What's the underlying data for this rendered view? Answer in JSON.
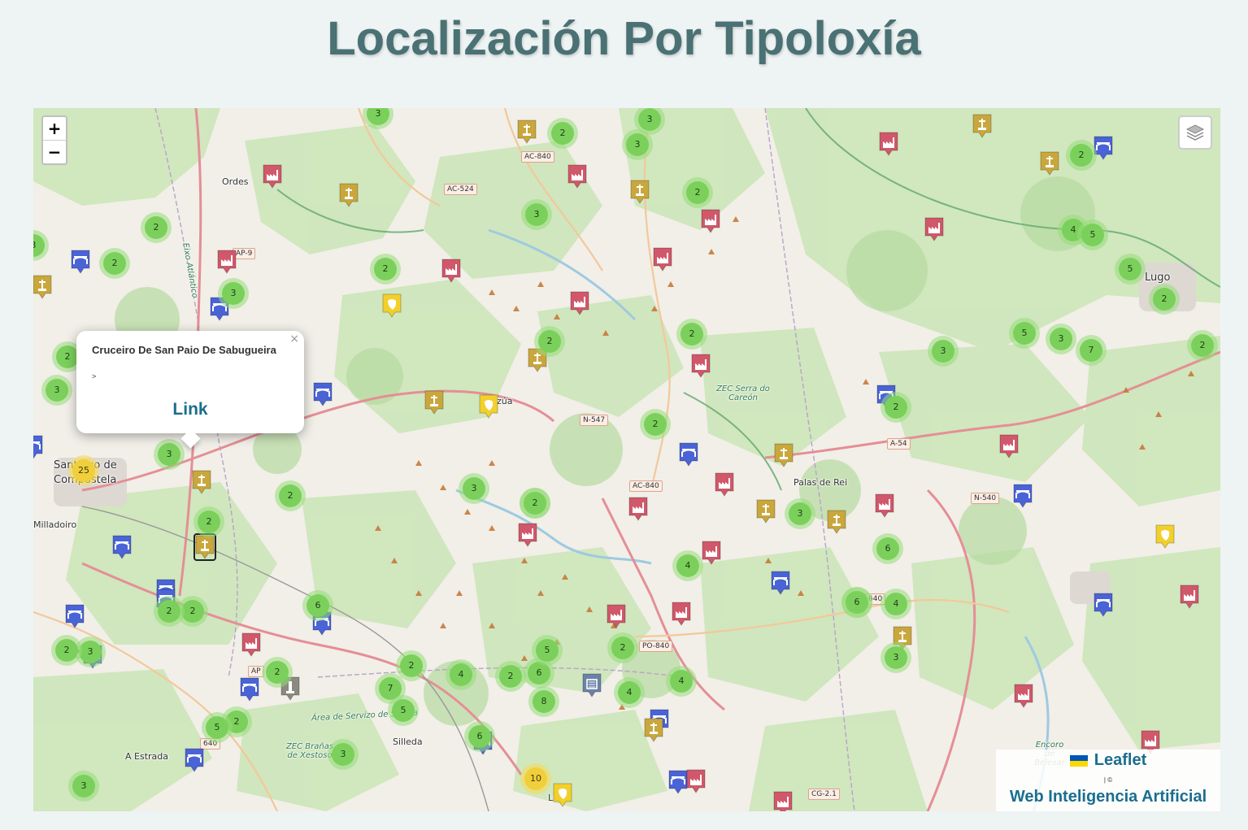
{
  "page": {
    "title": "Localización Por Tipoloxía"
  },
  "map": {
    "zoom_in_label": "+",
    "zoom_out_label": "−",
    "layers_icon": "layers-icon",
    "place_labels": [
      {
        "text": "Ordes",
        "cls": ""
      },
      {
        "text": "Lugo",
        "cls": "big"
      },
      {
        "text": "Santiago de",
        "cls": "big"
      },
      {
        "text": "Compostela",
        "cls": "big"
      },
      {
        "text": "Milladoiro",
        "cls": ""
      },
      {
        "text": "Palas de Rei",
        "cls": ""
      },
      {
        "text": "A Estrada",
        "cls": ""
      },
      {
        "text": "Silleda",
        "cls": ""
      },
      {
        "text": "Lalín",
        "cls": ""
      },
      {
        "text": "zúa",
        "cls": ""
      },
      {
        "text": "ZEC Serra do Careón",
        "cls": "italic"
      },
      {
        "text": "Área de Servizo de Silleda",
        "cls": "italic"
      },
      {
        "text": "ZEC Brañas de Xestoso",
        "cls": "italic"
      },
      {
        "text": "Encoro de Belesar",
        "cls": "italic"
      },
      {
        "text": "Eixo Atlántico",
        "cls": "italic"
      }
    ],
    "road_refs": [
      "AC-840",
      "AC-524",
      "N-547",
      "A-54",
      "AC-840",
      "N-540",
      "PO-840",
      "CG-2.1",
      "AP-9",
      "640",
      "PO",
      "AP",
      "640"
    ],
    "clusters": [
      {
        "count": "3",
        "color": "green"
      },
      {
        "count": "2",
        "color": "green"
      },
      {
        "count": "3",
        "color": "green"
      },
      {
        "count": "3",
        "color": "green"
      },
      {
        "count": "2",
        "color": "green"
      },
      {
        "count": "3",
        "color": "green"
      },
      {
        "count": "2",
        "color": "green"
      },
      {
        "count": "2",
        "color": "green"
      },
      {
        "count": "3",
        "color": "green"
      },
      {
        "count": "2",
        "color": "green"
      },
      {
        "count": "2",
        "color": "green"
      },
      {
        "count": "4",
        "color": "green"
      },
      {
        "count": "5",
        "color": "green"
      },
      {
        "count": "5",
        "color": "green"
      },
      {
        "count": "2",
        "color": "green"
      },
      {
        "count": "5",
        "color": "green"
      },
      {
        "count": "3",
        "color": "green"
      },
      {
        "count": "7",
        "color": "green"
      },
      {
        "count": "2",
        "color": "green"
      },
      {
        "count": "3",
        "color": "green"
      },
      {
        "count": "2",
        "color": "green"
      },
      {
        "count": "2",
        "color": "green"
      },
      {
        "count": "2",
        "color": "green"
      },
      {
        "count": "3",
        "color": "green"
      },
      {
        "count": "2",
        "color": "green"
      },
      {
        "count": "2",
        "color": "green"
      },
      {
        "count": "3",
        "color": "green"
      },
      {
        "count": "2",
        "color": "green"
      },
      {
        "count": "3",
        "color": "green"
      },
      {
        "count": "2",
        "color": "green"
      },
      {
        "count": "3",
        "color": "green"
      },
      {
        "count": "4",
        "color": "green"
      },
      {
        "count": "6",
        "color": "green"
      },
      {
        "count": "6",
        "color": "green"
      },
      {
        "count": "4",
        "color": "green"
      },
      {
        "count": "2",
        "color": "green"
      },
      {
        "count": "2",
        "color": "green"
      },
      {
        "count": "3",
        "color": "green"
      },
      {
        "count": "2",
        "color": "green"
      },
      {
        "count": "3",
        "color": "green"
      },
      {
        "count": "4",
        "color": "green"
      },
      {
        "count": "2",
        "color": "green"
      },
      {
        "count": "6",
        "color": "green"
      },
      {
        "count": "8",
        "color": "green"
      },
      {
        "count": "5",
        "color": "green"
      },
      {
        "count": "7",
        "color": "green"
      },
      {
        "count": "5",
        "color": "green"
      },
      {
        "count": "2",
        "color": "green"
      },
      {
        "count": "4",
        "color": "green"
      },
      {
        "count": "4",
        "color": "green"
      },
      {
        "count": "2",
        "color": "green"
      },
      {
        "count": "6",
        "color": "green"
      },
      {
        "count": "2",
        "color": "green"
      },
      {
        "count": "6",
        "color": "green"
      },
      {
        "count": "3",
        "color": "green"
      },
      {
        "count": "2",
        "color": "green"
      },
      {
        "count": "5",
        "color": "green"
      },
      {
        "count": "2",
        "color": "green"
      },
      {
        "count": "6",
        "color": "green"
      },
      {
        "count": "2",
        "color": "green"
      },
      {
        "count": "3",
        "color": "green"
      },
      {
        "count": "3",
        "color": "green"
      },
      {
        "count": "25",
        "color": "yellow"
      },
      {
        "count": "10",
        "color": "yellow"
      }
    ],
    "marker_types": {
      "wayside-cross": {
        "color": "#c9a73d",
        "icon": "cross-icon"
      },
      "factory": {
        "color": "#d0586a",
        "icon": "factory-icon"
      },
      "bridge": {
        "color": "#4a63d6",
        "icon": "bridge-icon"
      },
      "natural-site": {
        "color": "#f2d02c",
        "icon": "leaf-icon"
      },
      "building": {
        "color": "#6b82a8",
        "icon": "building-icon"
      },
      "monument": {
        "color": "#8a8a80",
        "icon": "monument-icon"
      }
    },
    "popup": {
      "title": "Cruceiro De San Paio De Sabugueira",
      "text": ">",
      "link": "Link",
      "close": "×"
    },
    "attribution": {
      "leaflet": "Leaflet",
      "separator": "| ©",
      "link": "Web Inteligencia Artificial",
      "flag_colors": [
        "#0057b7",
        "#ffd700"
      ]
    }
  }
}
